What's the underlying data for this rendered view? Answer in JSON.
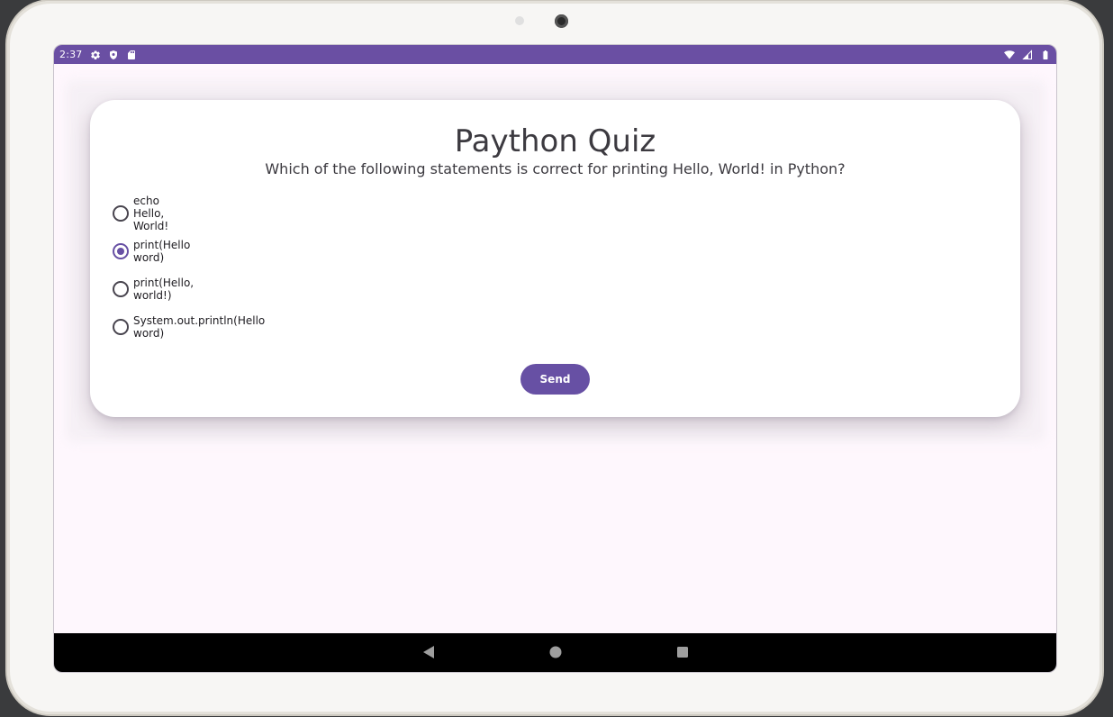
{
  "status_bar": {
    "time": "2:37",
    "left_icons": [
      "settings-icon",
      "shield-icon",
      "sd-card-icon"
    ],
    "right_icons": [
      "wifi-icon",
      "cellular-signal-icon",
      "battery-icon"
    ],
    "color": "#6a4fa3"
  },
  "quiz": {
    "title": "Paython Quiz",
    "question": "Which of the following statements is correct for printing Hello, World! in Python?",
    "options": [
      {
        "label": "echo Hello, World!",
        "selected": false
      },
      {
        "label": "print(Hello word)",
        "selected": true
      },
      {
        "label": "print(Hello, world!)",
        "selected": false
      },
      {
        "label": "System.out.println(Hello word)",
        "selected": false
      }
    ],
    "send_label": "Send",
    "accent_color": "#6750a4",
    "background_color": "#fef7fd"
  },
  "nav_bar": {
    "buttons": [
      "back-icon",
      "home-icon",
      "recents-icon"
    ]
  }
}
